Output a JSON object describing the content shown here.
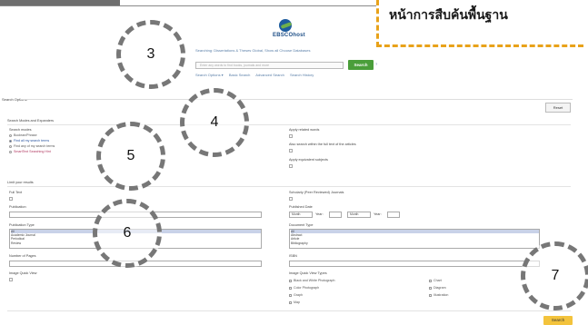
{
  "callout": {
    "text": "หน้าการสืบค้นพื้นฐาน"
  },
  "logo": {
    "text": "EBSCOhost"
  },
  "search": {
    "heading": "Searching: Dissertations & Theses Global, Show all Choose Databases",
    "placeholder": "Enter any words to find books, journals and more",
    "button": "Search",
    "help": "?",
    "links": [
      "Search Options ▾",
      "Basic Search",
      "Advanced Search",
      "Search History"
    ]
  },
  "markers": [
    "3",
    "4",
    "5",
    "6",
    "7"
  ],
  "options": {
    "title": "Search Options",
    "reset": "Reset",
    "modes_title": "Search Modes and Expanders",
    "modes_label": "Search modes",
    "modes": [
      "Boolean/Phrase",
      "Find all my search terms",
      "Find any of my search terms",
      "SmartText Searching Hint"
    ],
    "selected_mode": 1,
    "apply_related": "Apply related words",
    "also_search": "Also search within the full text of the articles",
    "apply_equivalent": "Apply equivalent subjects",
    "limit_title": "Limit your results",
    "full_text": "Full Text",
    "scholarly": "Scholarly (Peer Reviewed) Journals",
    "publication": "Publication",
    "published_date": "Published Date",
    "month_from": "Month",
    "year_label": "Year:",
    "month_to": "Month",
    "year_label2": "Year:",
    "publication_type": "Publication Type",
    "publication_types": [
      "All",
      "Academic Journal",
      "Periodical",
      "Review"
    ],
    "document_type": "Document Type",
    "document_types": [
      "All",
      "Abstract",
      "Article",
      "Bibliography"
    ],
    "pages": "Number of Pages",
    "image_quick_view": "Image Quick View",
    "isbn": "ISBN",
    "image_types_title": "Image Quick View Types",
    "image_types_left": [
      "Black and White Photograph",
      "Color Photograph",
      "Graph",
      "Map"
    ],
    "image_types_right": [
      "Chart",
      "Diagram",
      "Illustration"
    ],
    "bottom_search": "Search"
  }
}
